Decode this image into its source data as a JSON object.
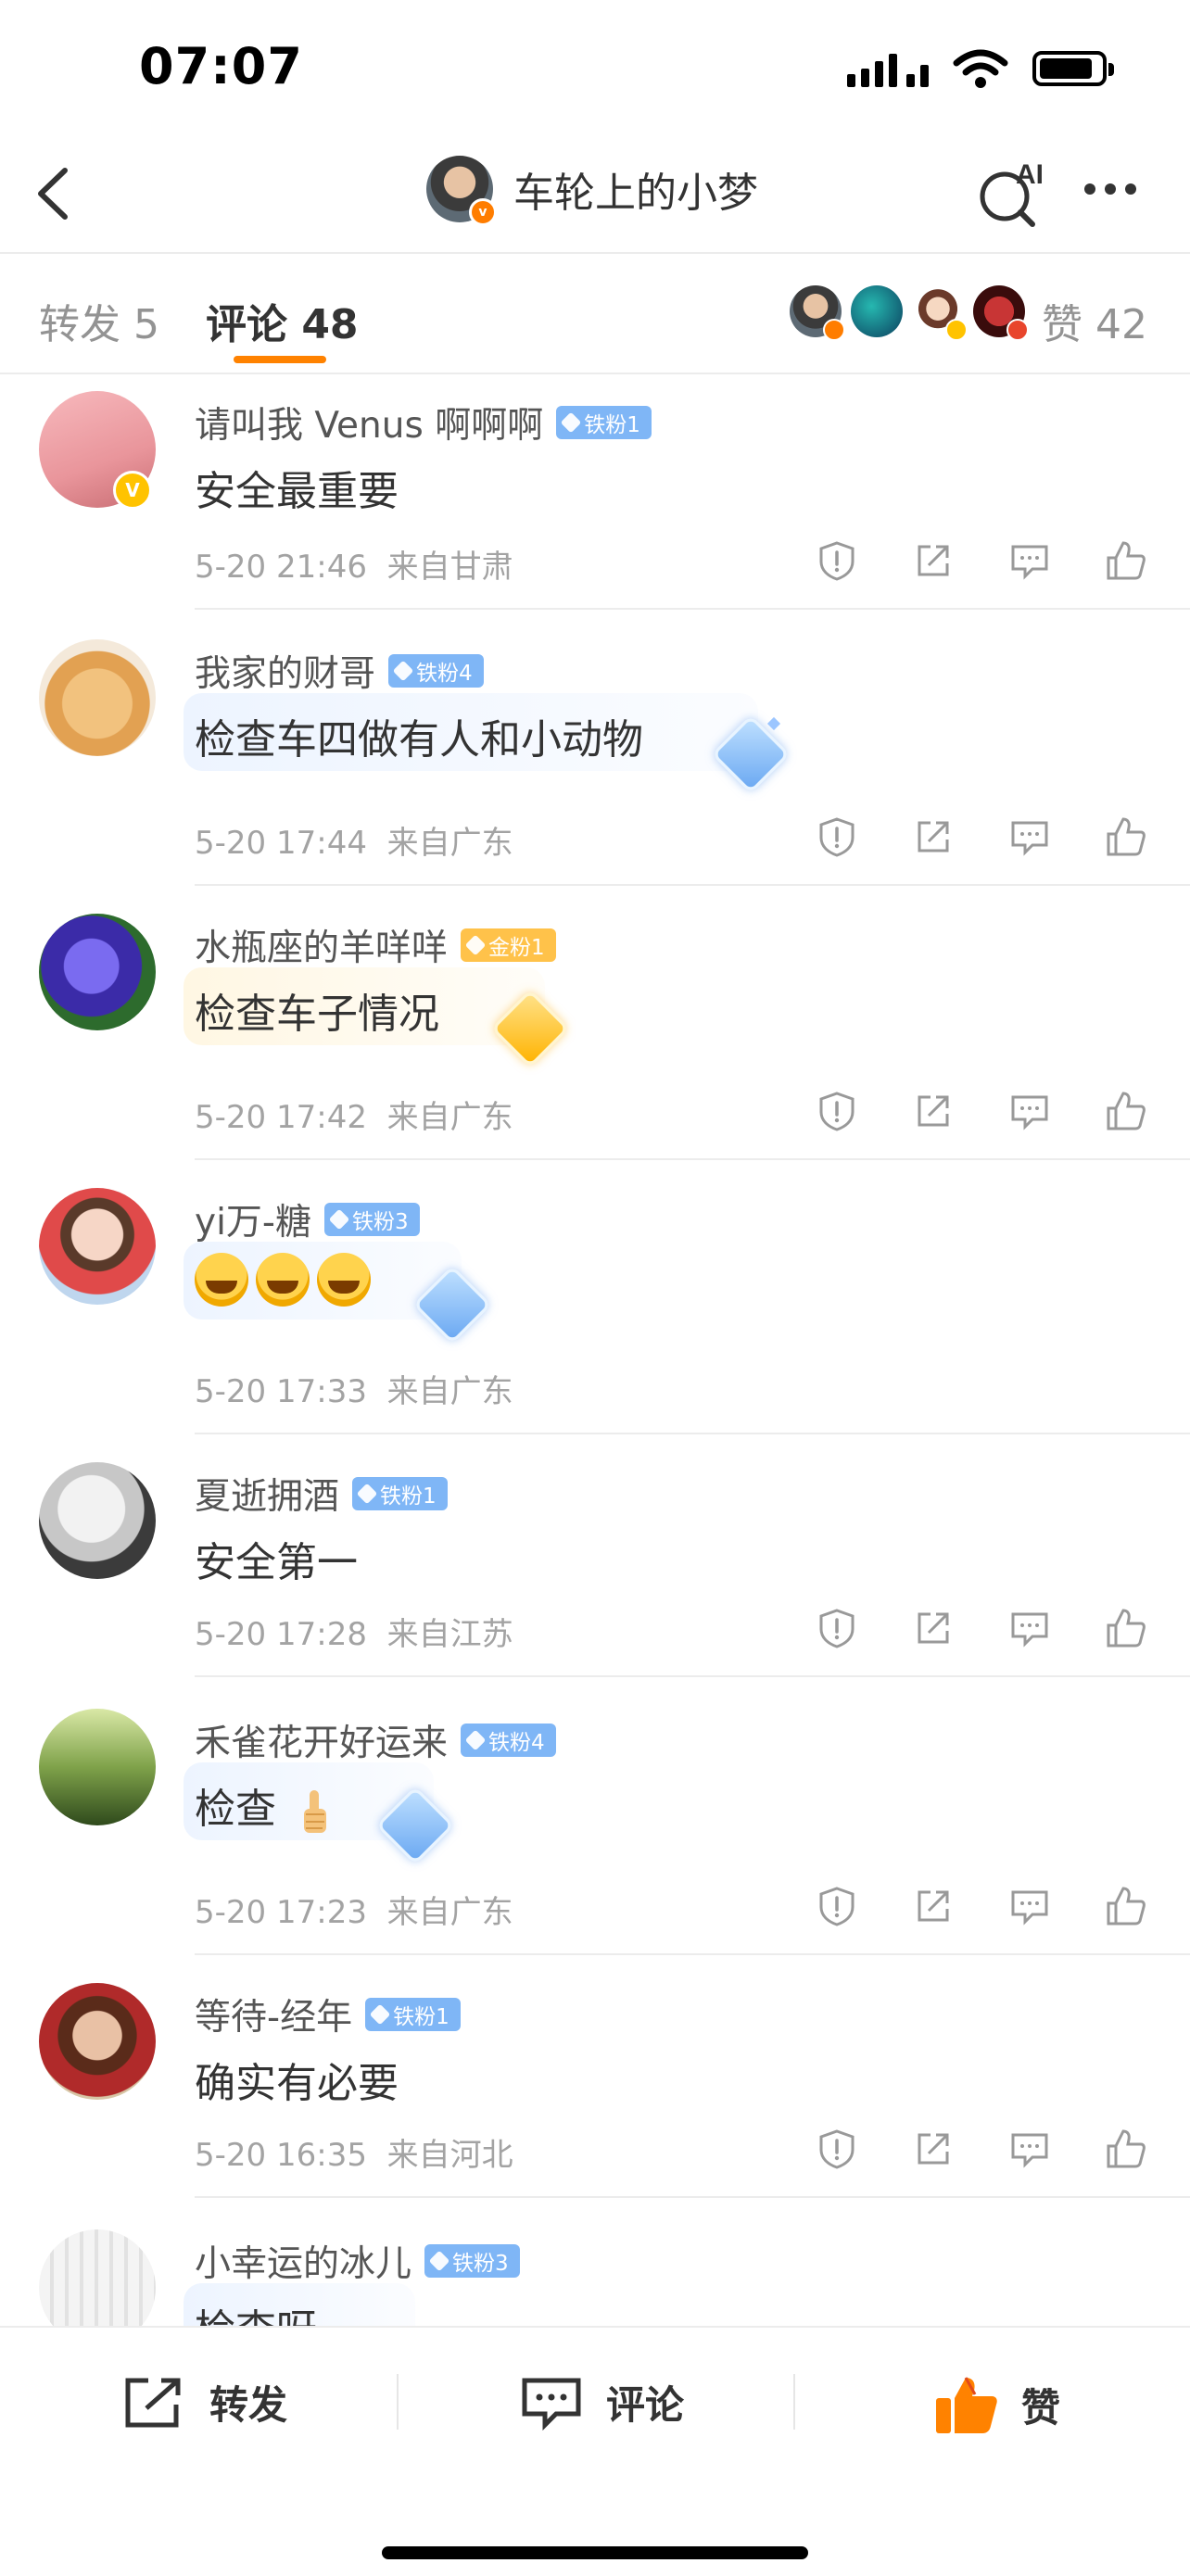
{
  "status": {
    "time": "07:07",
    "battery_level": 0.88
  },
  "nav": {
    "title": "车轮上的小梦",
    "ai_label": "AI"
  },
  "tabs": {
    "repost": "转发 5",
    "comment": "评论 48",
    "like": "赞 42"
  },
  "comments": [
    {
      "name": "请叫我 Venus 啊啊啊",
      "badge": "铁粉1",
      "badge_type": "iron",
      "text": "安全最重要",
      "time": "5-20 21:46",
      "location": "来自甘肃",
      "verified": true
    },
    {
      "name": "我家的财哥",
      "badge": "铁粉4",
      "badge_type": "iron",
      "text": "检查车四做有人和小动物",
      "time": "5-20 17:44",
      "location": "来自广东"
    },
    {
      "name": "水瓶座的羊咩咩",
      "badge": "金粉1",
      "badge_type": "gold",
      "text": "检查车子情况",
      "time": "5-20 17:42",
      "location": "来自广东"
    },
    {
      "name": "yi万-糖",
      "badge": "铁粉3",
      "badge_type": "iron",
      "text": "",
      "emoji": "laughing-tears x3",
      "time": "5-20 17:33",
      "location": "来自广东"
    },
    {
      "name": "夏逝拥酒",
      "badge": "铁粉1",
      "badge_type": "iron",
      "text": "安全第一",
      "time": "5-20 17:28",
      "location": "来自江苏"
    },
    {
      "name": "禾雀花开好运来",
      "badge": "铁粉4",
      "badge_type": "iron",
      "text": "检查",
      "emoji": "thumbs-up",
      "time": "5-20 17:23",
      "location": "来自广东"
    },
    {
      "name": "等待-经年",
      "badge": "铁粉1",
      "badge_type": "iron",
      "text": "确实有必要",
      "time": "5-20 16:35",
      "location": "来自河北"
    },
    {
      "name": "小幸运的冰儿",
      "badge": "铁粉3",
      "badge_type": "iron",
      "text": "检查呀"
    }
  ],
  "bottom": {
    "repost": "转发",
    "comment": "评论",
    "like": "赞"
  },
  "colors": {
    "accent": "#ff8200",
    "iron_badge": "#7fb6f6",
    "gold_badge": "#ffc24a",
    "meta": "#a3a3a3"
  }
}
